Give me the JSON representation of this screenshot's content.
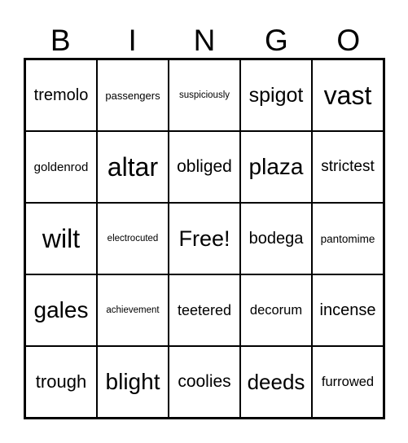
{
  "header": [
    "B",
    "I",
    "N",
    "G",
    "O"
  ],
  "cells": [
    [
      "tremolo",
      "passengers",
      "suspiciously",
      "spigot",
      "vast"
    ],
    [
      "goldenrod",
      "altar",
      "obliged",
      "plaza",
      "strictest"
    ],
    [
      "wilt",
      "electrocuted",
      "Free!",
      "bodega",
      "pantomime"
    ],
    [
      "gales",
      "achievement",
      "teetered",
      "decorum",
      "incense"
    ],
    [
      "trough",
      "blight",
      "coolies",
      "deeds",
      "furrowed"
    ]
  ]
}
